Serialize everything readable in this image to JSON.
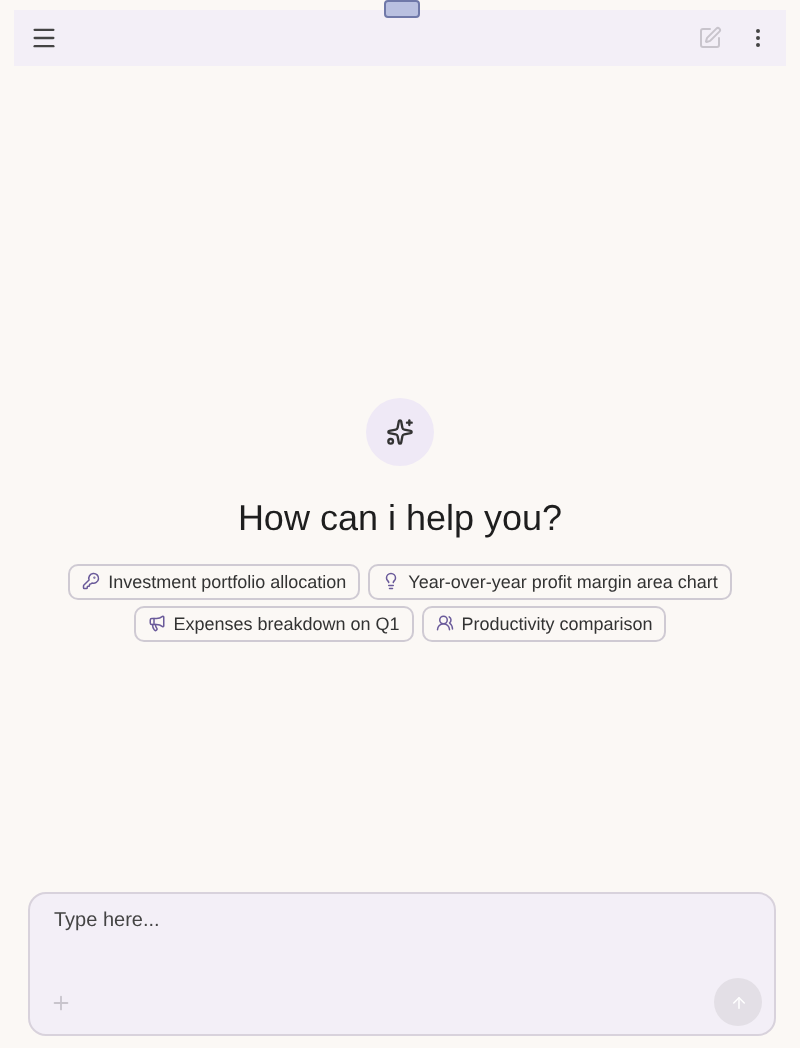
{
  "header": {
    "new_chat_disabled": true
  },
  "greeting": "How can i help you?",
  "suggestions": [
    {
      "label": "Investment portfolio allocation"
    },
    {
      "label": "Year-over-year profit margin area chart"
    },
    {
      "label": "Expenses breakdown on Q1"
    },
    {
      "label": "Productivity comparison"
    }
  ],
  "composer": {
    "placeholder": "Type here...",
    "send_disabled": true
  }
}
